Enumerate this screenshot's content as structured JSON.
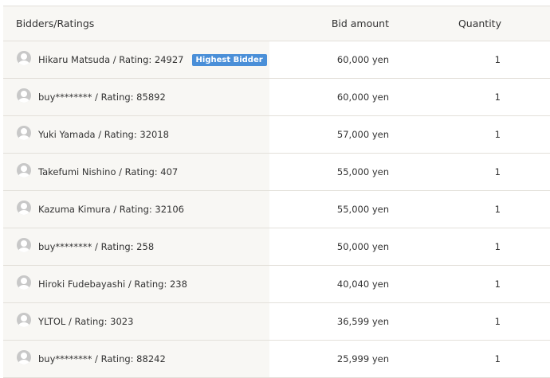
{
  "header": {
    "bidder_label": "Bidders/Ratings",
    "amount_label": "Bid amount",
    "quantity_label": "Quantity"
  },
  "badge": {
    "label": "Highest Bidder",
    "color": "#4a8fd8"
  },
  "rows": [
    {
      "bidder": "Hikaru Matsuda / Rating: 24927",
      "amount": "60,000 yen",
      "quantity": "1",
      "highest": true
    },
    {
      "bidder": "buy******** / Rating: 85892",
      "amount": "60,000 yen",
      "quantity": "1"
    },
    {
      "bidder": "Yuki Yamada / Rating: 32018",
      "amount": "57,000 yen",
      "quantity": "1"
    },
    {
      "bidder": "Takefumi Nishino / Rating: 407",
      "amount": "55,000 yen",
      "quantity": "1"
    },
    {
      "bidder": "Kazuma Kimura / Rating: 32106",
      "amount": "55,000 yen",
      "quantity": "1"
    },
    {
      "bidder": "buy******** / Rating: 258",
      "amount": "50,000 yen",
      "quantity": "1"
    },
    {
      "bidder": "Hiroki Fudebayashi / Rating: 238",
      "amount": "40,040 yen",
      "quantity": "1"
    },
    {
      "bidder": "YLTOL / Rating: 3023",
      "amount": "36,599 yen",
      "quantity": "1"
    },
    {
      "bidder": "buy******** / Rating: 88242",
      "amount": "25,999 yen",
      "quantity": "1"
    }
  ]
}
